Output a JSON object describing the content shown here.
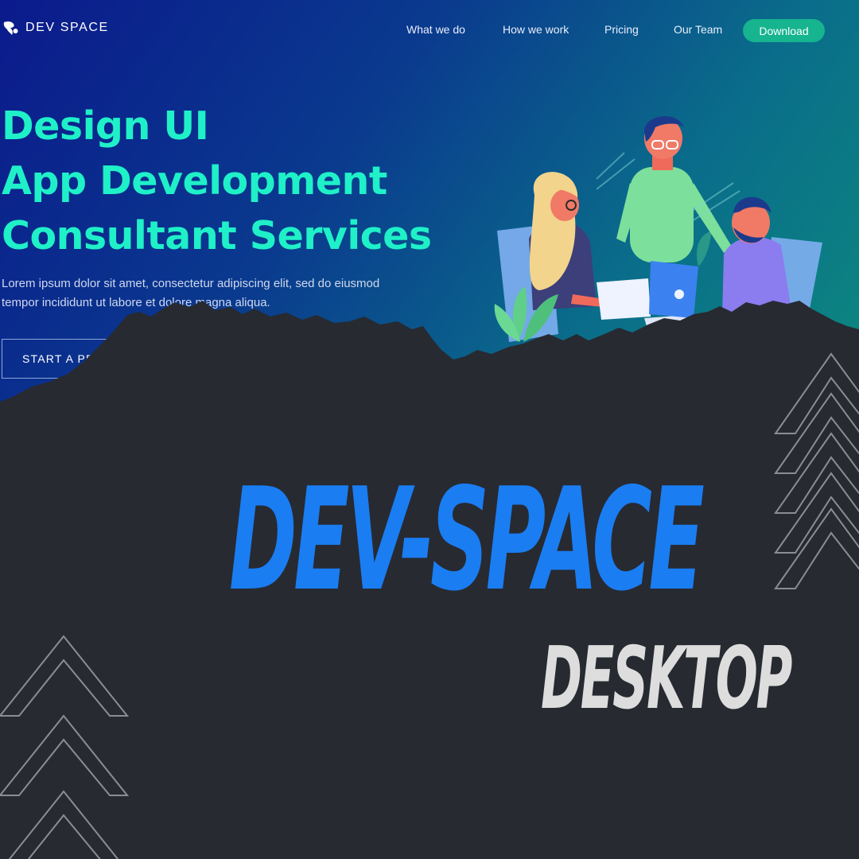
{
  "brand": {
    "name": "DEV SPACE"
  },
  "nav": {
    "items": [
      "What we do",
      "How we work",
      "Pricing",
      "Our Team"
    ],
    "download_label": "Download"
  },
  "hero": {
    "headline": [
      "Design UI",
      "App Development",
      "Consultant Services"
    ],
    "lede_line1": "Lorem ipsum dolor sit amet, consectetur adipiscing elit, sed do eiusmod",
    "lede_line2": "tempor incididunt ut labore et dolore magna aliqua.",
    "cta_label": "START A PR"
  },
  "overlay": {
    "title": "DEV-SPACE",
    "subtitle": "DESKTOP"
  },
  "colors": {
    "hero_start": "#0b1a8c",
    "hero_end": "#0d8a7e",
    "headline": "#1ff0c8",
    "download": "#16b48f",
    "overlay_bg": "#272a31",
    "title": "#1a7df2",
    "subtitle": "#dddddd"
  }
}
